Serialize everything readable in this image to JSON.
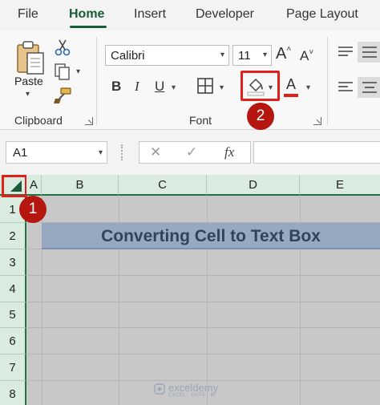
{
  "tabs": [
    {
      "label": "File",
      "active": false
    },
    {
      "label": "Home",
      "active": true
    },
    {
      "label": "Insert",
      "active": false
    },
    {
      "label": "Developer",
      "active": false
    },
    {
      "label": "Page Layout",
      "active": false
    }
  ],
  "ribbon": {
    "clipboard": {
      "label": "Clipboard",
      "paste_label": "Paste"
    },
    "font": {
      "label": "Font",
      "font_name": "Calibri",
      "font_size": "11",
      "bold": "B",
      "italic": "I",
      "underline": "U",
      "font_color_glyph": "A",
      "grow_glyph": "A",
      "shrink_glyph": "A"
    }
  },
  "formula_bar": {
    "name_box": "A1",
    "cancel": "✕",
    "enter": "✓",
    "fx": "fx",
    "formula": ""
  },
  "grid": {
    "columns": [
      "A",
      "B",
      "C",
      "D",
      "E"
    ],
    "rows": [
      "1",
      "2",
      "3",
      "4",
      "5",
      "6",
      "7",
      "8"
    ],
    "title_cell": "Converting Cell to Text Box"
  },
  "annotations": {
    "step1": "1",
    "step2": "2"
  },
  "watermark": {
    "name": "exceldemy",
    "tagline": "EXCEL · DATA · BI"
  },
  "colors": {
    "accent": "#217346",
    "tab_active": "#185c37",
    "highlight": "#e0201b",
    "step_badge": "#b5160f",
    "title_fill": "#97a9c0"
  }
}
